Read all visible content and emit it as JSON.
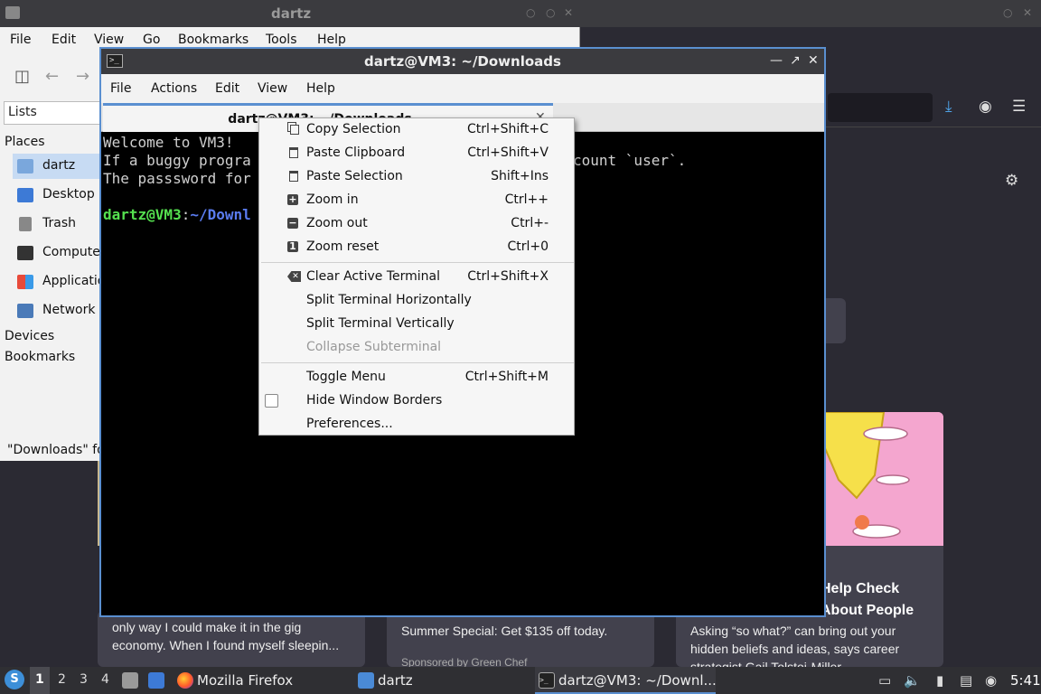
{
  "filemanager": {
    "title": "dartz",
    "menu": [
      "File",
      "Edit",
      "View",
      "Go",
      "Bookmarks",
      "Tools",
      "Help"
    ],
    "lists_label": "Lists",
    "places_heading": "Places",
    "places": [
      {
        "label": "dartz",
        "icon": "home-folder-icon"
      },
      {
        "label": "Desktop",
        "icon": "desktop-icon"
      },
      {
        "label": "Trash",
        "icon": "trash-icon"
      },
      {
        "label": "Compute",
        "icon": "computer-icon"
      },
      {
        "label": "Applicatio",
        "icon": "applications-icon"
      },
      {
        "label": "Network",
        "icon": "network-icon"
      }
    ],
    "devices_heading": "Devices",
    "bookmarks_heading": "Bookmarks",
    "status": "\"Downloads\" fo"
  },
  "terminal": {
    "title": "dartz@VM3: ~/Downloads",
    "menu": [
      "File",
      "Actions",
      "Edit",
      "View",
      "Help"
    ],
    "tab_label": "dartz@VM3: ~/Downloads",
    "lines": [
      "Welcome to VM3!",
      "If a buggy progra",
      "The passsword for"
    ],
    "line2_tail": "count `user`.",
    "prompt_user": "dartz@VM3",
    "prompt_colon": ":",
    "prompt_path": "~/Downl"
  },
  "context_menu": {
    "items": [
      {
        "label": "Copy Selection",
        "shortcut": "Ctrl+Shift+C",
        "icon": "copy-icon"
      },
      {
        "label": "Paste Clipboard",
        "shortcut": "Ctrl+Shift+V",
        "icon": "paste-icon"
      },
      {
        "label": "Paste Selection",
        "shortcut": "Shift+Ins",
        "icon": "paste-icon"
      },
      {
        "label": "Zoom in",
        "shortcut": "Ctrl++",
        "icon": "zoom-in-icon"
      },
      {
        "label": "Zoom out",
        "shortcut": "Ctrl+-",
        "icon": "zoom-out-icon"
      },
      {
        "label": "Zoom reset",
        "shortcut": "Ctrl+0",
        "icon": "zoom-reset-icon"
      },
      {
        "label": "Clear Active Terminal",
        "shortcut": "Ctrl+Shift+X",
        "icon": "clear-icon"
      },
      {
        "label": "Split Terminal Horizontally",
        "shortcut": ""
      },
      {
        "label": "Split Terminal Vertically",
        "shortcut": ""
      },
      {
        "label": "Collapse Subterminal",
        "shortcut": "",
        "disabled": true
      },
      {
        "label": "Toggle Menu",
        "shortcut": "Ctrl+Shift+M"
      },
      {
        "label": "Hide Window Borders",
        "shortcut": "",
        "checkbox": false
      },
      {
        "label": "Preferences...",
        "shortcut": ""
      }
    ]
  },
  "firefox": {
    "cards": [
      {
        "text": "only way I could make it in the gig economy. When I found myself sleepin..."
      },
      {
        "text": "Summer Special: Get $135 off today.",
        "sponsor": "Sponsored by Green Chef"
      },
      {
        "title": "Help Check About People",
        "text": "Asking “so what?” can bring out your hidden beliefs and ideas, says career strategist Gail Tolstoi-Miller."
      }
    ]
  },
  "taskbar": {
    "workspaces": [
      "1",
      "2",
      "3",
      "4"
    ],
    "active_workspace": "1",
    "tasks": [
      {
        "label": "Mozilla Firefox",
        "icon": "firefox-icon"
      },
      {
        "label": "dartz",
        "icon": "folder-icon"
      },
      {
        "label": "dartz@VM3: ~/Downl...",
        "icon": "terminal-icon"
      }
    ],
    "clock": "5:41"
  },
  "colors": {
    "accent": "#5a8fd0",
    "prompt_user": "#55e04f",
    "prompt_path": "#5a7cf0",
    "terminal_bg": "#000000"
  }
}
